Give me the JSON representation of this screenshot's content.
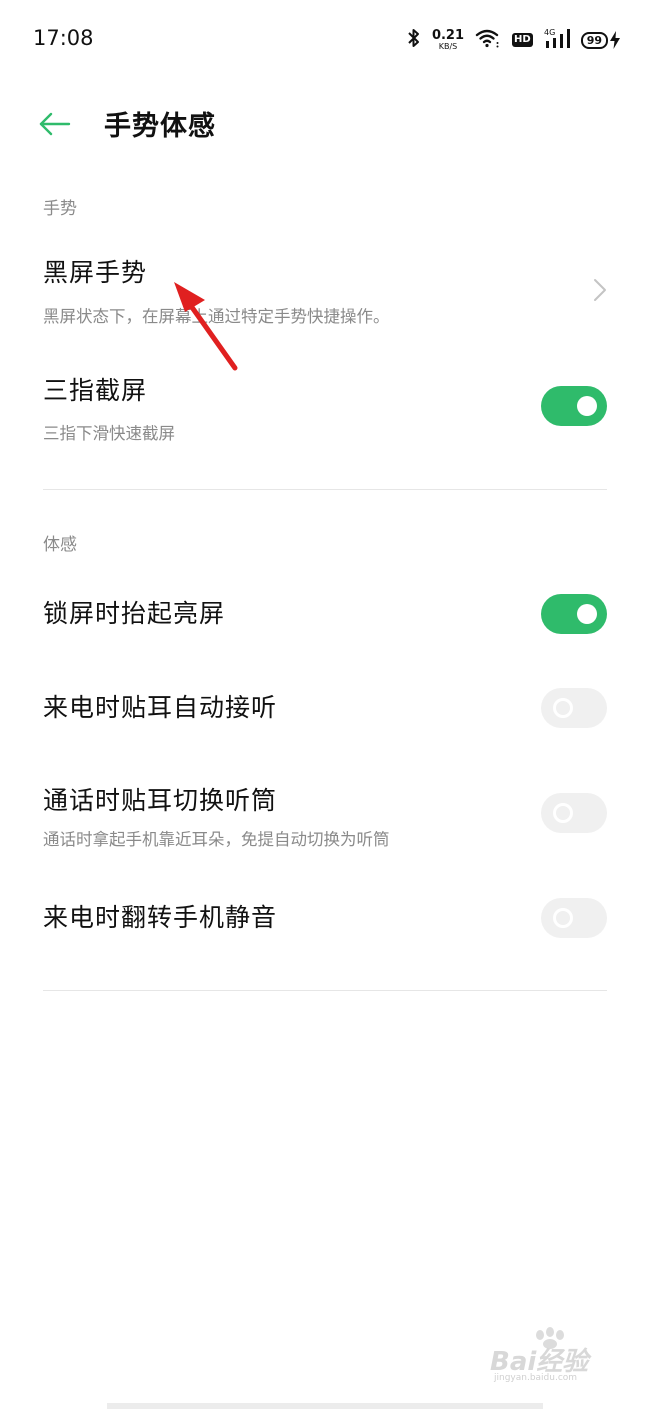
{
  "status_bar": {
    "time": "17:08",
    "net_speed_value": "0.21",
    "net_speed_unit": "KB/S",
    "hd_label": "HD",
    "network_type": "4G",
    "battery_level": "99",
    "icons": [
      "bluetooth-icon",
      "wifi-icon",
      "hd-icon",
      "signal-icon",
      "battery-icon",
      "charging-icon"
    ]
  },
  "header": {
    "back_icon": "back-arrow-icon",
    "title": "手势体感"
  },
  "sections": {
    "gesture": {
      "header": "手势",
      "items": [
        {
          "title": "黑屏手势",
          "subtitle": "黑屏状态下，在屏幕上通过特定手势快捷操作。",
          "control": "chevron"
        },
        {
          "title": "三指截屏",
          "subtitle": "三指下滑快速截屏",
          "control": "toggle",
          "enabled": true
        }
      ]
    },
    "motion": {
      "header": "体感",
      "items": [
        {
          "title": "锁屏时抬起亮屏",
          "control": "toggle",
          "enabled": true
        },
        {
          "title": "来电时贴耳自动接听",
          "control": "toggle",
          "enabled": false
        },
        {
          "title": "通话时贴耳切换听筒",
          "subtitle": "通话时拿起手机靠近耳朵，免提自动切换为听筒",
          "control": "toggle",
          "enabled": false
        },
        {
          "title": "来电时翻转手机静音",
          "control": "toggle",
          "enabled": false
        }
      ]
    }
  },
  "watermark": {
    "logo": "Bai经验",
    "url": "jingyan.baidu.com"
  },
  "colors": {
    "accent": "#2fbb6b",
    "toggle_off": "#f0f0f0",
    "secondary_text": "#8a8a8a",
    "annotation_arrow": "#e02020"
  }
}
